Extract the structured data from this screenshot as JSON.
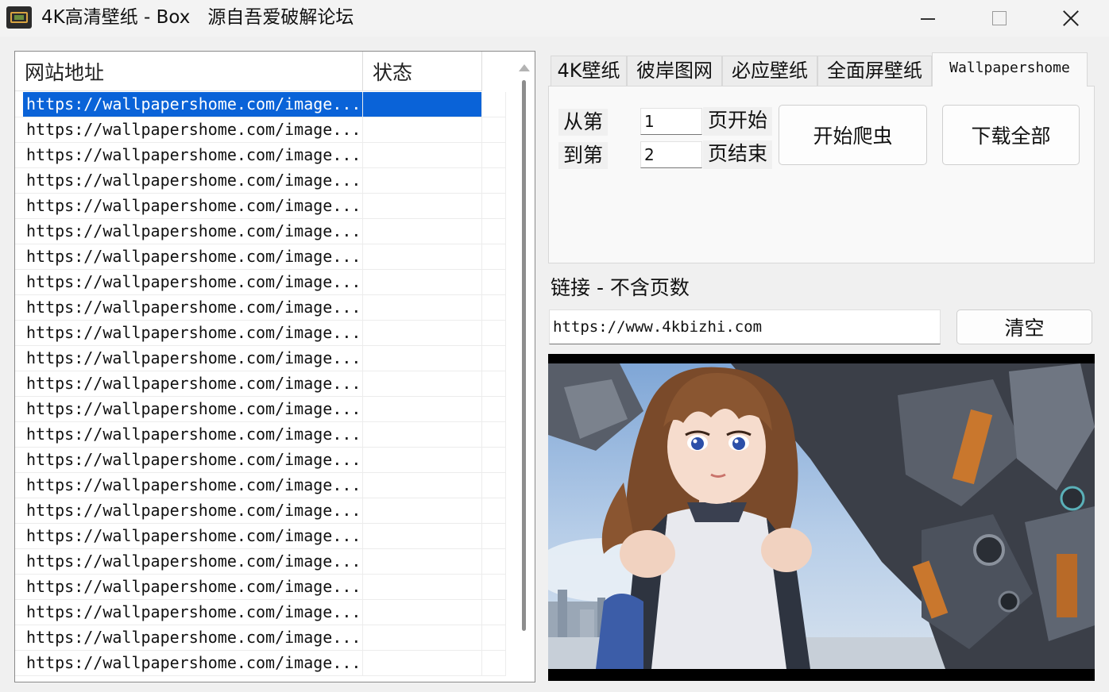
{
  "window": {
    "title": "4K高清壁纸 - Box   源自吾爱破解论坛"
  },
  "list": {
    "columns": {
      "url": "网站地址",
      "status": "状态"
    },
    "rows": [
      "https://wallpapershome.com/image...",
      "https://wallpapershome.com/image...",
      "https://wallpapershome.com/image...",
      "https://wallpapershome.com/image...",
      "https://wallpapershome.com/image...",
      "https://wallpapershome.com/image...",
      "https://wallpapershome.com/image...",
      "https://wallpapershome.com/image...",
      "https://wallpapershome.com/image...",
      "https://wallpapershome.com/image...",
      "https://wallpapershome.com/image...",
      "https://wallpapershome.com/image...",
      "https://wallpapershome.com/image...",
      "https://wallpapershome.com/image...",
      "https://wallpapershome.com/image...",
      "https://wallpapershome.com/image...",
      "https://wallpapershome.com/image...",
      "https://wallpapershome.com/image...",
      "https://wallpapershome.com/image...",
      "https://wallpapershome.com/image...",
      "https://wallpapershome.com/image...",
      "https://wallpapershome.com/image...",
      "https://wallpapershome.com/image..."
    ],
    "selected_index": 0,
    "selection_color": "#0a63d8"
  },
  "tabs": [
    "4K壁纸",
    "彼岸图网",
    "必应壁纸",
    "全面屏壁纸",
    "Wallpapershome"
  ],
  "active_tab": "Wallpapershome",
  "crawl": {
    "from_label": "从第",
    "from_value": "1",
    "from_suffix": "页开始",
    "to_label": "到第",
    "to_value": "2",
    "to_suffix": "页结束",
    "start_button": "开始爬虫",
    "download_button": "下载全部"
  },
  "link": {
    "label": "链接 - 不含页数",
    "value": "https://www.4kbizhi.com",
    "clear_button": "清空"
  },
  "icons": {
    "minimize": "minimize-icon",
    "maximize": "maximize-icon",
    "close": "close-icon",
    "app": "app-icon"
  }
}
